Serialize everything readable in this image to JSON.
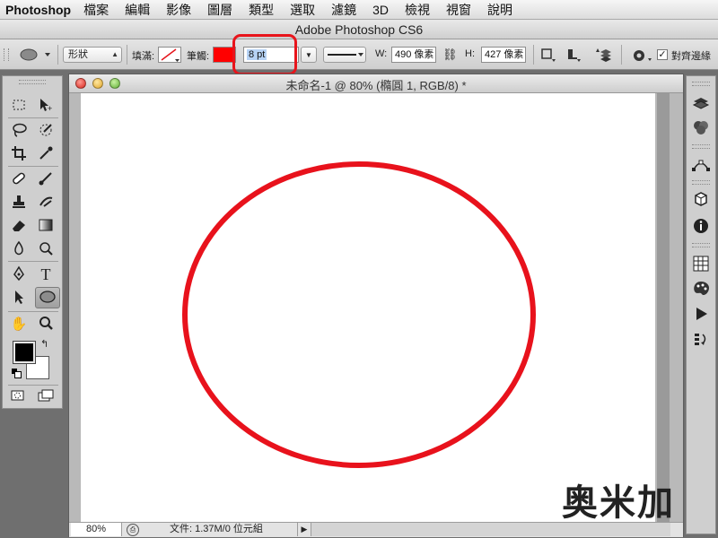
{
  "menubar": {
    "app_name": "Photoshop",
    "items": [
      "檔案",
      "編輯",
      "影像",
      "圖層",
      "類型",
      "選取",
      "濾鏡",
      "3D",
      "檢視",
      "視窗",
      "說明"
    ]
  },
  "app_title": "Adobe Photoshop CS6",
  "options": {
    "mode_value": "形狀",
    "fill_label": "填滿:",
    "stroke_label": "筆觸:",
    "stroke_color": "#ff0000",
    "stroke_width": "8 pt",
    "w_label": "W:",
    "w_value": "490 像素",
    "h_label": "H:",
    "h_value": "427 像素",
    "align_edges_label": "對齊邊緣",
    "align_edges_checked": true
  },
  "document": {
    "title": "未命名-1 @ 80% (橢圓 1, RGB/8) *",
    "zoom": "80%",
    "doc_info": "文件: 1.37M/0 位元組",
    "ellipse_stroke": "#e8121c"
  },
  "toolbox": {
    "tools": [
      "rectangular-marquee-icon",
      "move-icon",
      "lasso-icon",
      "quick-selection-icon",
      "crop-icon",
      "eyedropper-icon",
      "healing-brush-icon",
      "brush-icon",
      "clone-stamp-icon",
      "history-brush-icon",
      "eraser-icon",
      "gradient-icon",
      "blur-icon",
      "dodge-icon",
      "pen-icon",
      "type-icon",
      "path-selection-icon",
      "ellipse-icon",
      "hand-icon",
      "zoom-icon"
    ],
    "foreground_color": "#000000",
    "background_color": "#ffffff"
  },
  "dock_icons": [
    "layers-icon",
    "channels-icon",
    "paths-icon",
    "3d-icon",
    "info-icon",
    "swatches-icon",
    "color-palette-icon",
    "actions-play-icon",
    "history-icon"
  ],
  "watermark": "奥米加"
}
